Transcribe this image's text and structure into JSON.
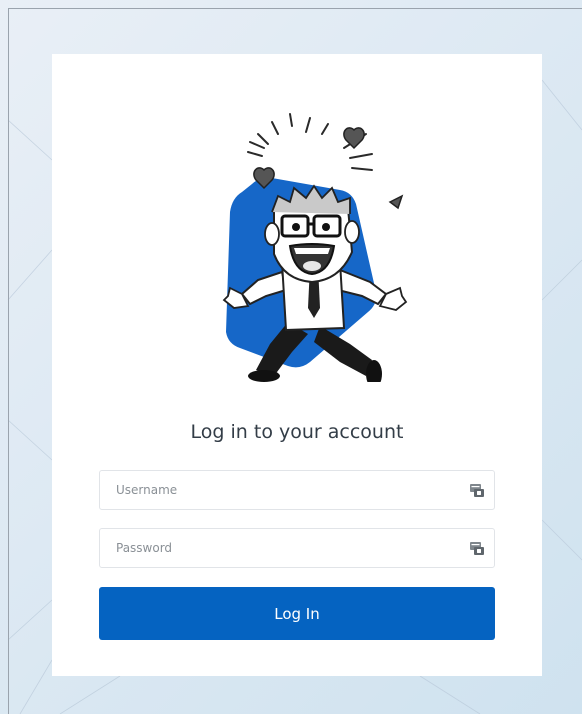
{
  "login": {
    "title": "Log in to your account",
    "username_placeholder": "Username",
    "password_placeholder": "Password",
    "login_button": "Log In"
  },
  "icons": {
    "mascot": "excited-cartoon-man-illustration",
    "username_field_icon": "credential-card-icon",
    "password_field_icon": "credential-card-icon"
  },
  "colors": {
    "accent": "#0563c1",
    "mascot_hexagon": "#1667c8",
    "title_text": "#333d47",
    "field_border": "#e1e4e8"
  }
}
